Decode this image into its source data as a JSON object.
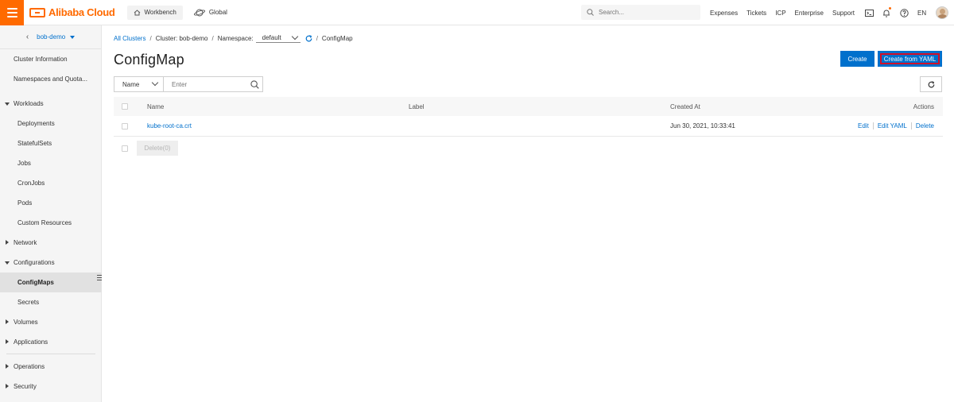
{
  "topbar": {
    "brand": "Alibaba Cloud",
    "workbench": "Workbench",
    "global": "Global",
    "search_placeholder": "Search...",
    "links": [
      "Expenses",
      "Tickets",
      "ICP",
      "Enterprise",
      "Support"
    ],
    "language": "EN"
  },
  "sidebar": {
    "cluster": "bob-demo",
    "items": {
      "cluster_information": "Cluster Information",
      "namespaces": "Namespaces and Quota...",
      "workloads": "Workloads",
      "deployments": "Deployments",
      "statefulsets": "StatefulSets",
      "jobs": "Jobs",
      "cronjobs": "CronJobs",
      "pods": "Pods",
      "custom_resources": "Custom Resources",
      "network": "Network",
      "configurations": "Configurations",
      "configmaps": "ConfigMaps",
      "secrets": "Secrets",
      "volumes": "Volumes",
      "applications": "Applications",
      "operations": "Operations",
      "security": "Security"
    }
  },
  "breadcrumb": {
    "all_clusters": "All Clusters",
    "cluster": "Cluster: bob-demo",
    "namespace_label": "Namespace:",
    "namespace_value": "default",
    "current": "ConfigMap"
  },
  "page": {
    "title": "ConfigMap",
    "create_label": "Create",
    "create_yaml_label": "Create from YAML"
  },
  "filter": {
    "field": "Name",
    "placeholder": "Enter"
  },
  "table": {
    "headers": {
      "name": "Name",
      "label": "Label",
      "created_at": "Created At",
      "actions": "Actions"
    },
    "rows": [
      {
        "name": "kube-root-ca.crt",
        "label": "",
        "created_at": "Jun 30, 2021, 10:33:41",
        "edit": "Edit",
        "edit_yaml": "Edit YAML",
        "delete": "Delete"
      }
    ],
    "delete_button": "Delete(0)"
  },
  "colors": {
    "brand": "#ff6a00",
    "primary": "#0070cc",
    "highlight_border": "#d0102a"
  }
}
